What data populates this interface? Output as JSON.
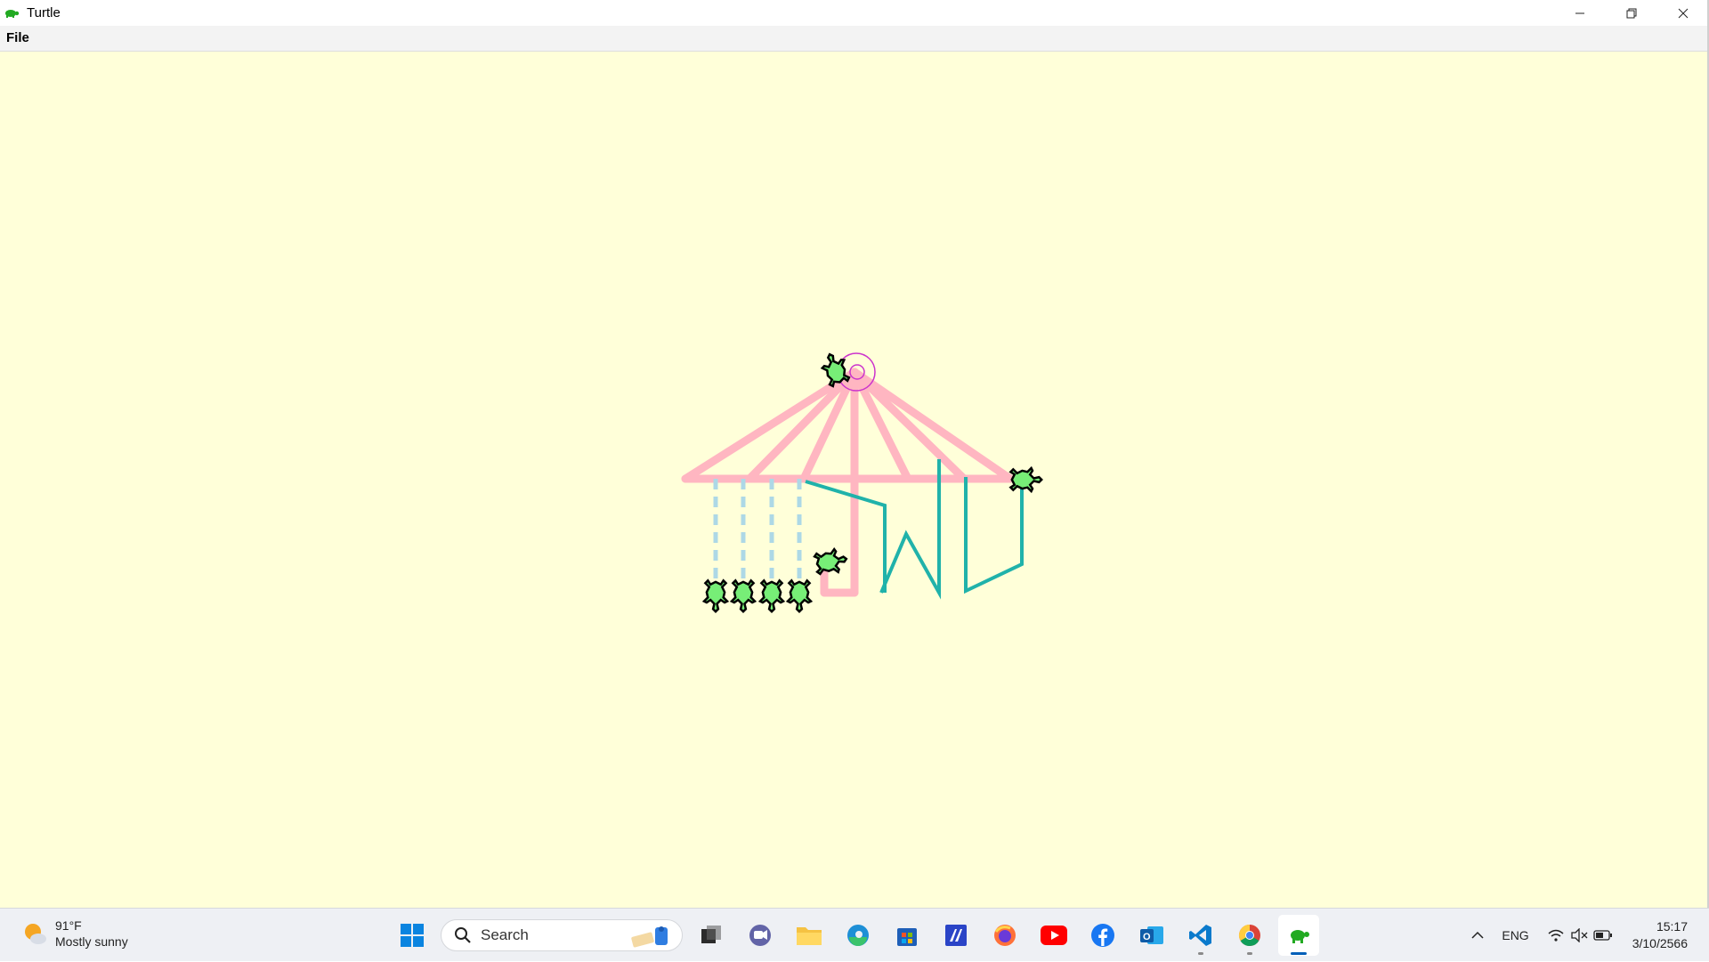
{
  "window": {
    "title": "Turtle",
    "controls": {
      "minimize": "minimize-icon",
      "restore": "restore-icon",
      "close": "close-icon"
    }
  },
  "menu": {
    "items": [
      {
        "label": "File"
      }
    ]
  },
  "canvas": {
    "background": "#ffffd9",
    "colors": {
      "pink": "#ffb6c1",
      "teal": "#20b2aa",
      "lightblue": "#add8e6",
      "turtle_fill": "#77ee77",
      "turtle_outline": "#000000",
      "circle": "#cc33cc"
    },
    "turtle_count": 7
  },
  "taskbar": {
    "weather": {
      "temp": "91°F",
      "condition": "Mostly sunny",
      "icon": "sun-cloud-icon"
    },
    "search": {
      "placeholder": "Search"
    },
    "apps": [
      {
        "name": "start-icon"
      },
      {
        "name": "task-view-icon"
      },
      {
        "name": "chat-icon"
      },
      {
        "name": "file-explorer-icon"
      },
      {
        "name": "edge-icon"
      },
      {
        "name": "store-icon"
      },
      {
        "name": "pen-app-icon"
      },
      {
        "name": "firefox-icon"
      },
      {
        "name": "youtube-icon"
      },
      {
        "name": "facebook-icon"
      },
      {
        "name": "outlook-icon"
      },
      {
        "name": "vscode-icon"
      },
      {
        "name": "chrome-icon"
      },
      {
        "name": "turtle-app-icon"
      }
    ],
    "tray": {
      "language": "ENG",
      "time": "15:17",
      "date": "3/10/2566"
    }
  }
}
